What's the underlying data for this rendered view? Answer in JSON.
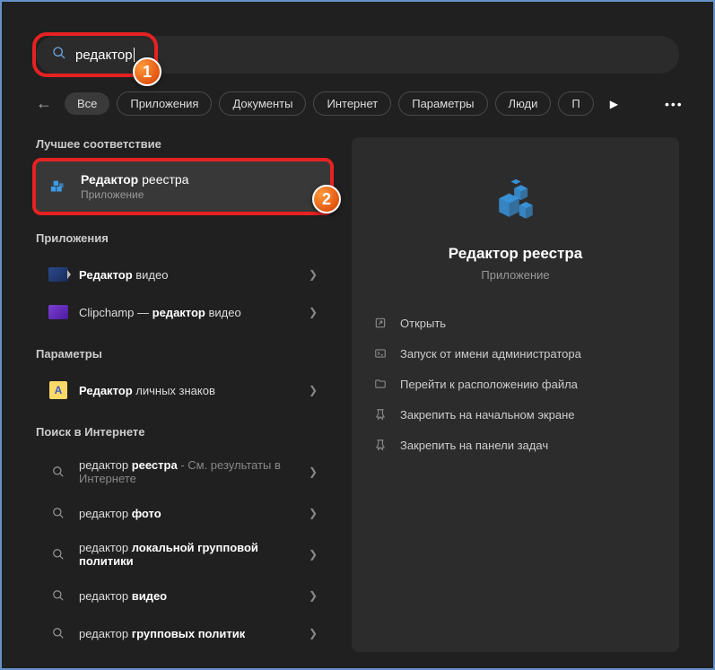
{
  "search": {
    "query": "редактор"
  },
  "filters": {
    "items": [
      "Все",
      "Приложения",
      "Документы",
      "Интернет",
      "Параметры",
      "Люди",
      "П"
    ]
  },
  "sections": {
    "best_match": "Лучшее соответствие",
    "apps": "Приложения",
    "settings": "Параметры",
    "web": "Поиск в Интернете"
  },
  "best": {
    "title_bold": "Редактор",
    "title_rest": " реестра",
    "subtitle": "Приложение"
  },
  "app_results": [
    {
      "prefix_bold": "Редактор",
      "rest": " видео",
      "icon": "video"
    },
    {
      "prefix": "Clipchamp — ",
      "mid_bold": "редактор",
      "rest": " видео",
      "icon": "clipchamp"
    }
  ],
  "settings_results": [
    {
      "prefix_bold": "Редактор",
      "rest": " личных знаков",
      "icon": "char"
    }
  ],
  "web_results": [
    {
      "prefix": "редактор ",
      "mid_bold": "реестра",
      "suffix": " - См. результаты в Интернете"
    },
    {
      "prefix": "редактор ",
      "mid_bold": "фото"
    },
    {
      "prefix": "редактор ",
      "mid_bold": "локальной групповой политики"
    },
    {
      "prefix": "редактор ",
      "mid_bold": "видео"
    },
    {
      "prefix": "редактор ",
      "mid_bold": "групповых политик"
    }
  ],
  "preview": {
    "title": "Редактор реестра",
    "subtitle": "Приложение",
    "actions": [
      {
        "icon": "open",
        "label": "Открыть"
      },
      {
        "icon": "admin",
        "label": "Запуск от имени администратора"
      },
      {
        "icon": "folder",
        "label": "Перейти к расположению файла"
      },
      {
        "icon": "pin",
        "label": "Закрепить на начальном экране"
      },
      {
        "icon": "pin",
        "label": "Закрепить на панели задач"
      }
    ]
  },
  "badges": {
    "one": "1",
    "two": "2"
  }
}
